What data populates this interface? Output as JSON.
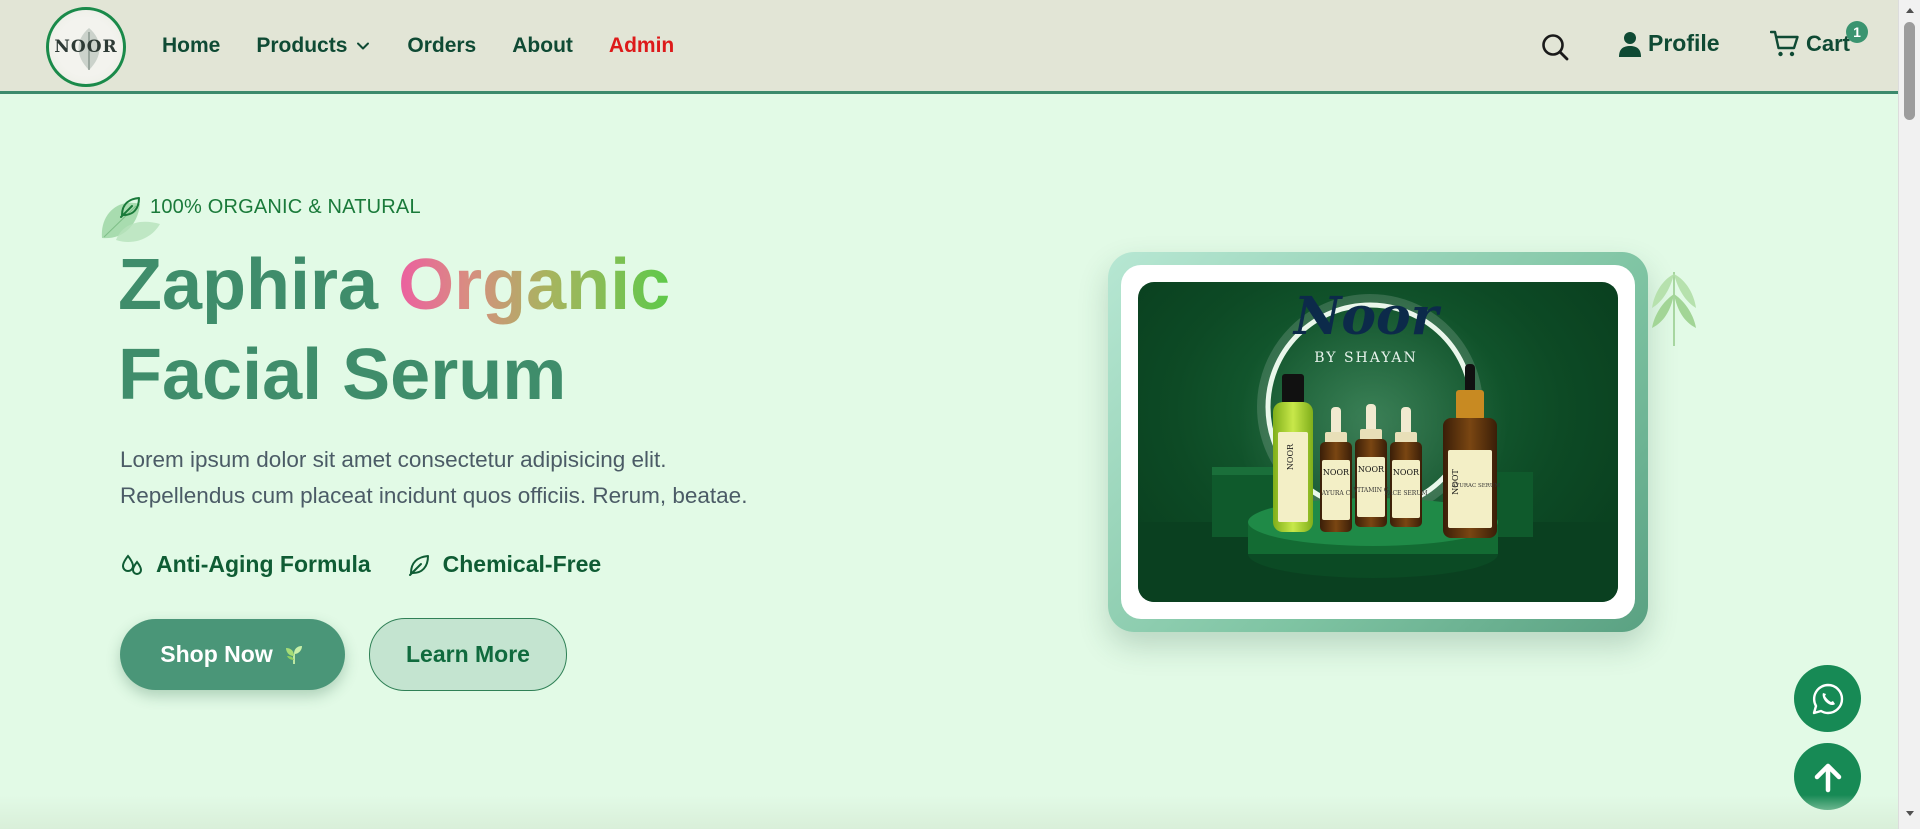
{
  "nav": {
    "logo_text": "NOOR",
    "links": [
      {
        "label": "Home"
      },
      {
        "label": "Products"
      },
      {
        "label": "Orders"
      },
      {
        "label": "About"
      },
      {
        "label": "Admin"
      }
    ],
    "profile_label": "Profile",
    "cart_label": "Cart",
    "cart_count": "1",
    "admin_color": "#dd1a1a",
    "icons": [
      "search-icon",
      "user-icon",
      "cart-icon",
      "chevron-down-icon"
    ]
  },
  "hero": {
    "tag": "100% ORGANIC & NATURAL",
    "title_part1": "Zaphira ",
    "title_highlight": "Organic",
    "title_line2": "Facial Serum",
    "description_line1": "Lorem ipsum dolor sit amet consectetur adipisicing elit.",
    "description_line2": "Repellendus cum placeat incidunt quos officiis. Rerum, beatae.",
    "features": [
      {
        "label": "Anti-Aging Formula",
        "icon": "droplets-icon"
      },
      {
        "label": "Chemical-Free",
        "icon": "leaf-icon"
      }
    ],
    "shop_button": "Shop Now",
    "learn_button": "Learn More"
  },
  "product_image": {
    "brand": "Noor",
    "brand_sub": "BY SHAYAN",
    "bottle_labels": [
      "NOOR",
      "NOOR",
      "NOOR",
      "NOOR",
      "NOOT"
    ],
    "label_lines": [
      "AYURA C",
      "VITAMIN C",
      "FACE SERUM",
      "AYURAC SERUM"
    ]
  },
  "floating": {
    "whatsapp_icon": "whatsapp-icon",
    "scroll_top_icon": "arrow-up-icon"
  },
  "colors": {
    "primary": "#4a9678",
    "dark_green": "#0f4a34",
    "background": "#e2fae6",
    "navbar": "#e2e5d6"
  }
}
